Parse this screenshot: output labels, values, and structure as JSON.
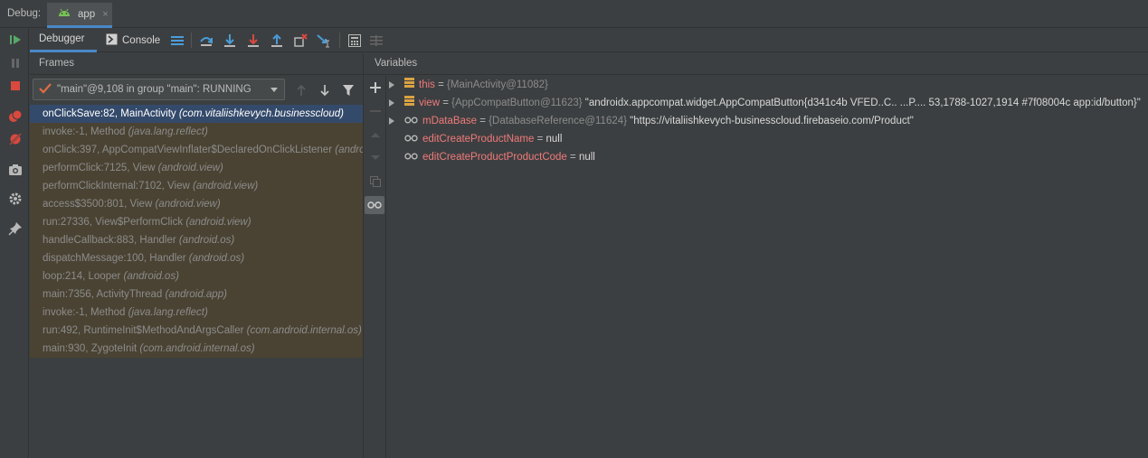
{
  "topbar": {
    "debug_label": "Debug:",
    "tab_label": "app",
    "tab_close": "×"
  },
  "toolbar": {
    "debugger_tab": "Debugger",
    "console_tab": "Console"
  },
  "frames": {
    "header": "Frames",
    "thread_selector": "\"main\"@9,108 in group \"main\": RUNNING",
    "items": [
      {
        "method": "onClickSave:82, MainActivity ",
        "pkg": "(com.vitaliishkevych.businesscloud)"
      },
      {
        "method": "invoke:-1, Method ",
        "pkg": "(java.lang.reflect)"
      },
      {
        "method": "onClick:397, AppCompatViewInflater$DeclaredOnClickListener ",
        "pkg": "(androidx.a"
      },
      {
        "method": "performClick:7125, View ",
        "pkg": "(android.view)"
      },
      {
        "method": "performClickInternal:7102, View ",
        "pkg": "(android.view)"
      },
      {
        "method": "access$3500:801, View ",
        "pkg": "(android.view)"
      },
      {
        "method": "run:27336, View$PerformClick ",
        "pkg": "(android.view)"
      },
      {
        "method": "handleCallback:883, Handler ",
        "pkg": "(android.os)"
      },
      {
        "method": "dispatchMessage:100, Handler ",
        "pkg": "(android.os)"
      },
      {
        "method": "loop:214, Looper ",
        "pkg": "(android.os)"
      },
      {
        "method": "main:7356, ActivityThread ",
        "pkg": "(android.app)"
      },
      {
        "method": "invoke:-1, Method ",
        "pkg": "(java.lang.reflect)"
      },
      {
        "method": "run:492, RuntimeInit$MethodAndArgsCaller ",
        "pkg": "(com.android.internal.os)"
      },
      {
        "method": "main:930, ZygoteInit ",
        "pkg": "(com.android.internal.os)"
      }
    ]
  },
  "variables": {
    "header": "Variables",
    "items": [
      {
        "name": "this",
        "eq": " = ",
        "type": "{MainActivity@11082}",
        "value": ""
      },
      {
        "name": "view",
        "eq": " = ",
        "type": "{AppCompatButton@11623} ",
        "value": "\"androidx.appcompat.widget.AppCompatButton{d341c4b VFED..C.. ...P.... 53,1788-1027,1914 #7f08004c app:id/button}\""
      },
      {
        "name": "mDataBase",
        "eq": " = ",
        "type": "{DatabaseReference@11624} ",
        "value": "\"https://vitaliishkevych-businesscloud.firebaseio.com/Product\""
      },
      {
        "name": "editCreateProductName",
        "eq": " = ",
        "type": "",
        "value": "null"
      },
      {
        "name": "editCreateProductProductCode",
        "eq": " = ",
        "type": "",
        "value": "null"
      }
    ]
  }
}
